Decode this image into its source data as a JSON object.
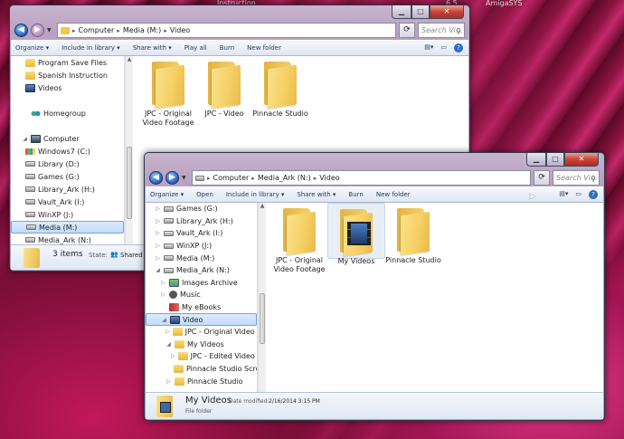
{
  "desktop": {
    "top_left": "Instruction",
    "top_right_num": "6.5",
    "top_right_label": "AmigaSYS"
  },
  "back_window": {
    "address": {
      "crumbs": [
        "Computer",
        "Media (M:)",
        "Video"
      ]
    },
    "search_placeholder": "Search Vi...",
    "toolbar": [
      "Organize ▾",
      "Include in library ▾",
      "Share with ▾",
      "Play all",
      "Burn",
      "New folder"
    ],
    "nav": [
      {
        "label": "Program Save Files",
        "icon": "folder"
      },
      {
        "label": "Spanish Instruction",
        "icon": "folder"
      },
      {
        "label": "Videos",
        "icon": "vid"
      },
      {
        "label": "",
        "icon": ""
      },
      {
        "label": "Homegroup",
        "icon": "home"
      },
      {
        "label": "",
        "icon": ""
      },
      {
        "label": "Computer",
        "icon": "comp"
      },
      {
        "label": "Windows7 (C:)",
        "icon": "winos"
      },
      {
        "label": "Library (D:)",
        "icon": "drive"
      },
      {
        "label": "Games (G:)",
        "icon": "drive"
      },
      {
        "label": "Library_Ark (H:)",
        "icon": "drive"
      },
      {
        "label": "Vault_Ark (I:)",
        "icon": "drive"
      },
      {
        "label": "WinXP (J:)",
        "icon": "drive"
      },
      {
        "label": "Media (M:)",
        "icon": "drive",
        "selected": true
      },
      {
        "label": "Media_Ark (N:)",
        "icon": "drive"
      }
    ],
    "tiles": [
      "JPC - Original Video Footage",
      "JPC - Video",
      "Pinnacle Studio"
    ],
    "details": {
      "count": "3 items",
      "state_label": "State:",
      "state_value": "Shared"
    }
  },
  "front_window": {
    "address": {
      "crumbs": [
        "Computer",
        "Media_Ark (N:)",
        "Video"
      ]
    },
    "search_placeholder": "Search Vi...",
    "toolbar": [
      "Organize ▾",
      "Open",
      "Include in library ▾",
      "Share with ▾",
      "Burn",
      "New folder"
    ],
    "nav": [
      {
        "label": "Games (G:)",
        "icon": "drive",
        "indent": 0,
        "tw": "▷"
      },
      {
        "label": "Library_Ark (H:)",
        "icon": "drive",
        "indent": 0,
        "tw": "▷"
      },
      {
        "label": "Vault_Ark (I:)",
        "icon": "drive",
        "indent": 0,
        "tw": "▷"
      },
      {
        "label": "WinXP (J:)",
        "icon": "drive",
        "indent": 0,
        "tw": "▷"
      },
      {
        "label": "Media (M:)",
        "icon": "drive",
        "indent": 0,
        "tw": "▷"
      },
      {
        "label": "Media_Ark (N:)",
        "icon": "drive",
        "indent": 0,
        "tw": "◢"
      },
      {
        "label": "Images Archive",
        "icon": "img",
        "indent": 1,
        "tw": "▷"
      },
      {
        "label": "Music",
        "icon": "music",
        "indent": 1,
        "tw": "▷"
      },
      {
        "label": "My eBooks",
        "icon": "book",
        "indent": 1,
        "tw": ""
      },
      {
        "label": "Video",
        "icon": "vid",
        "indent": 1,
        "tw": "◢",
        "selected": true
      },
      {
        "label": "JPC - Original Video Foo",
        "icon": "folder",
        "indent": 2,
        "tw": "▷"
      },
      {
        "label": "My Videos",
        "icon": "folder",
        "indent": 2,
        "tw": "◢"
      },
      {
        "label": "JPC - Edited Video File",
        "icon": "folder",
        "indent": 3,
        "tw": "▷"
      },
      {
        "label": "Pinnacle Studio Screen",
        "icon": "folder",
        "indent": 3,
        "tw": ""
      },
      {
        "label": "Pinnacle Studio",
        "icon": "folder",
        "indent": 2,
        "tw": "▷"
      }
    ],
    "tiles": [
      {
        "label": "JPC - Original Video Footage",
        "film": false,
        "selected": false
      },
      {
        "label": "My Videos",
        "film": true,
        "selected": true
      },
      {
        "label": "Pinnacle Studio",
        "film": false,
        "selected": false
      }
    ],
    "details": {
      "name": "My Videos",
      "modified_label": "Date modified:",
      "modified_value": "2/16/2014 3:15 PM",
      "type": "File folder"
    }
  }
}
